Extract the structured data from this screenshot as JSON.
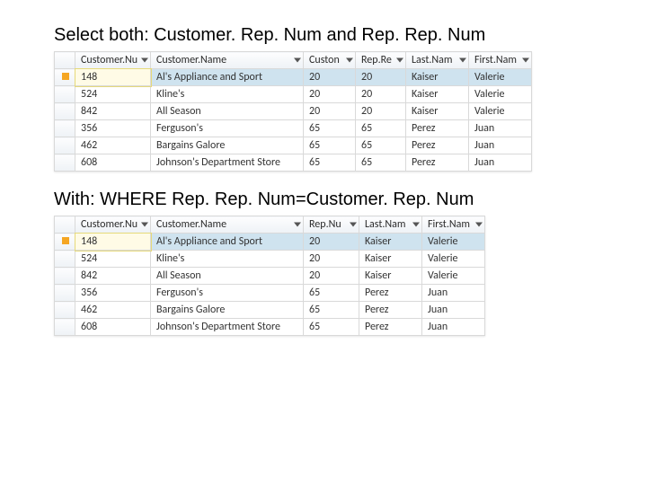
{
  "caption1": "Select both: Customer. Rep. Num and Rep. Rep. Num",
  "caption2": "With: WHERE Rep. Rep. Num=Customer. Rep. Num",
  "table1": {
    "headers": [
      "Customer.Nu",
      "Customer.Name",
      "Custon",
      "Rep.Re",
      "Last.Nam",
      "First.Nam"
    ],
    "rows": [
      {
        "num": "148",
        "name": "Al's Appliance and Sport",
        "a": "20",
        "b": "20",
        "last": "Kaiser",
        "first": "Valerie",
        "selected": true,
        "edit": true
      },
      {
        "num": "524",
        "name": "Kline's",
        "a": "20",
        "b": "20",
        "last": "Kaiser",
        "first": "Valerie"
      },
      {
        "num": "842",
        "name": "All Season",
        "a": "20",
        "b": "20",
        "last": "Kaiser",
        "first": "Valerie"
      },
      {
        "num": "356",
        "name": "Ferguson's",
        "a": "65",
        "b": "65",
        "last": "Perez",
        "first": "Juan"
      },
      {
        "num": "462",
        "name": "Bargains Galore",
        "a": "65",
        "b": "65",
        "last": "Perez",
        "first": "Juan"
      },
      {
        "num": "608",
        "name": "Johnson's Department Store",
        "a": "65",
        "b": "65",
        "last": "Perez",
        "first": "Juan"
      }
    ]
  },
  "table2": {
    "headers": [
      "Customer.Nu",
      "Customer.Name",
      "Rep.Nu",
      "Last.Nam",
      "First.Nam"
    ],
    "rows": [
      {
        "num": "148",
        "name": "Al's Appliance and Sport",
        "rep": "20",
        "last": "Kaiser",
        "first": "Valerie",
        "selected": true,
        "edit": true
      },
      {
        "num": "524",
        "name": "Kline's",
        "rep": "20",
        "last": "Kaiser",
        "first": "Valerie"
      },
      {
        "num": "842",
        "name": "All Season",
        "rep": "20",
        "last": "Kaiser",
        "first": "Valerie"
      },
      {
        "num": "356",
        "name": "Ferguson's",
        "rep": "65",
        "last": "Perez",
        "first": "Juan"
      },
      {
        "num": "462",
        "name": "Bargains Galore",
        "rep": "65",
        "last": "Perez",
        "first": "Juan"
      },
      {
        "num": "608",
        "name": "Johnson's Department Store",
        "rep": "65",
        "last": "Perez",
        "first": "Juan"
      }
    ]
  }
}
